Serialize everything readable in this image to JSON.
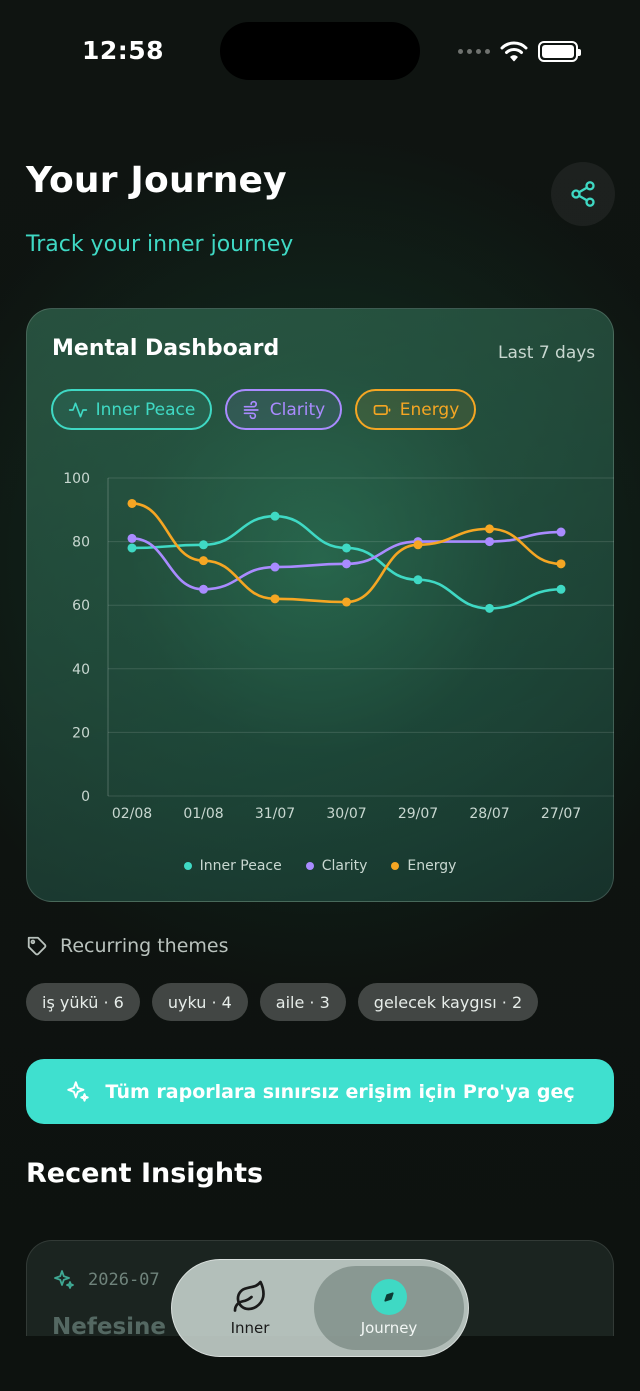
{
  "status_bar": {
    "time": "12:58"
  },
  "header": {
    "title": "Your Journey",
    "subtitle": "Track your inner journey"
  },
  "dashboard": {
    "title": "Mental Dashboard",
    "range": "Last 7 days",
    "filters": [
      {
        "label": "Inner Peace",
        "icon": "activity-icon",
        "color": "#3fd9c4"
      },
      {
        "label": "Clarity",
        "icon": "wind-icon",
        "color": "#a98bff"
      },
      {
        "label": "Energy",
        "icon": "battery-icon",
        "color": "#f5a623"
      }
    ]
  },
  "chart_data": {
    "type": "line",
    "x": [
      "02/08",
      "01/08",
      "31/07",
      "30/07",
      "29/07",
      "28/07",
      "27/07"
    ],
    "ylim": [
      0,
      100
    ],
    "yticks": [
      0,
      20,
      40,
      60,
      80,
      100
    ],
    "grid": true,
    "legend_position": "bottom",
    "series": [
      {
        "name": "Inner Peace",
        "color": "#3fd9c4",
        "values": [
          78,
          79,
          88,
          78,
          68,
          59,
          65
        ]
      },
      {
        "name": "Clarity",
        "color": "#a98bff",
        "values": [
          81,
          65,
          72,
          73,
          80,
          80,
          83
        ]
      },
      {
        "name": "Energy",
        "color": "#f5a623",
        "values": [
          92,
          74,
          62,
          61,
          79,
          84,
          73
        ]
      }
    ]
  },
  "themes": {
    "label": "Recurring themes",
    "tags": [
      "iş yükü · 6",
      "uyku · 4",
      "aile · 3",
      "gelecek kaygısı · 2"
    ]
  },
  "pro_button": {
    "label": "Tüm raporlara sınırsız erişim için Pro'ya geç"
  },
  "insights": {
    "title": "Recent Insights",
    "items": [
      {
        "date": "2026-07",
        "text": "Nefesine"
      }
    ]
  },
  "tabbar": {
    "tabs": [
      {
        "label": "Inner",
        "icon": "leaf-icon"
      },
      {
        "label": "Journey",
        "icon": "compass-icon"
      }
    ]
  }
}
